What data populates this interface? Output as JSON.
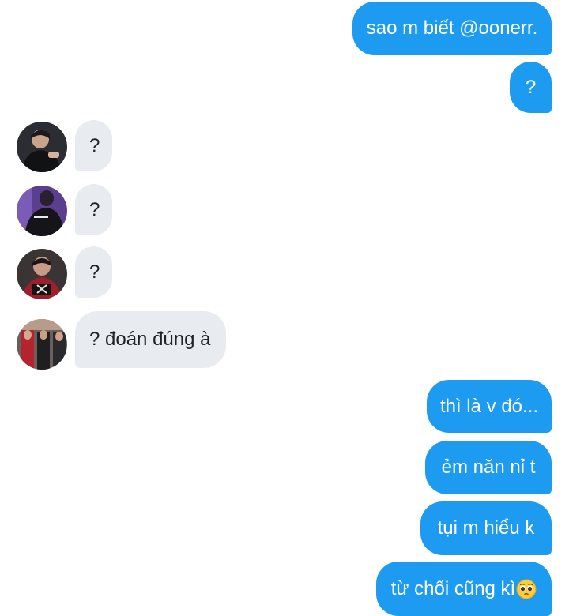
{
  "conversation": {
    "messages": [
      {
        "sender": "me",
        "text": "sao m biết @oonerr."
      },
      {
        "sender": "me",
        "text": "?"
      },
      {
        "sender": "other",
        "text": "?"
      },
      {
        "sender": "other",
        "text": "?"
      },
      {
        "sender": "other",
        "text": "?"
      },
      {
        "sender": "other",
        "text": "? đoán đúng à"
      },
      {
        "sender": "me",
        "text": "thì là v đó..."
      },
      {
        "sender": "me",
        "text": "ẻm năn nỉ t"
      },
      {
        "sender": "me",
        "text": "tụi m hiểu k"
      },
      {
        "sender": "me",
        "text": "từ chối cũng kì",
        "emoji": "pleading-face-emoji"
      }
    ]
  },
  "colors": {
    "outgoing_bubble": "#1d9bf0",
    "incoming_bubble": "#e8ecf0",
    "outgoing_text": "#ffffff",
    "incoming_text": "#1f2328"
  }
}
